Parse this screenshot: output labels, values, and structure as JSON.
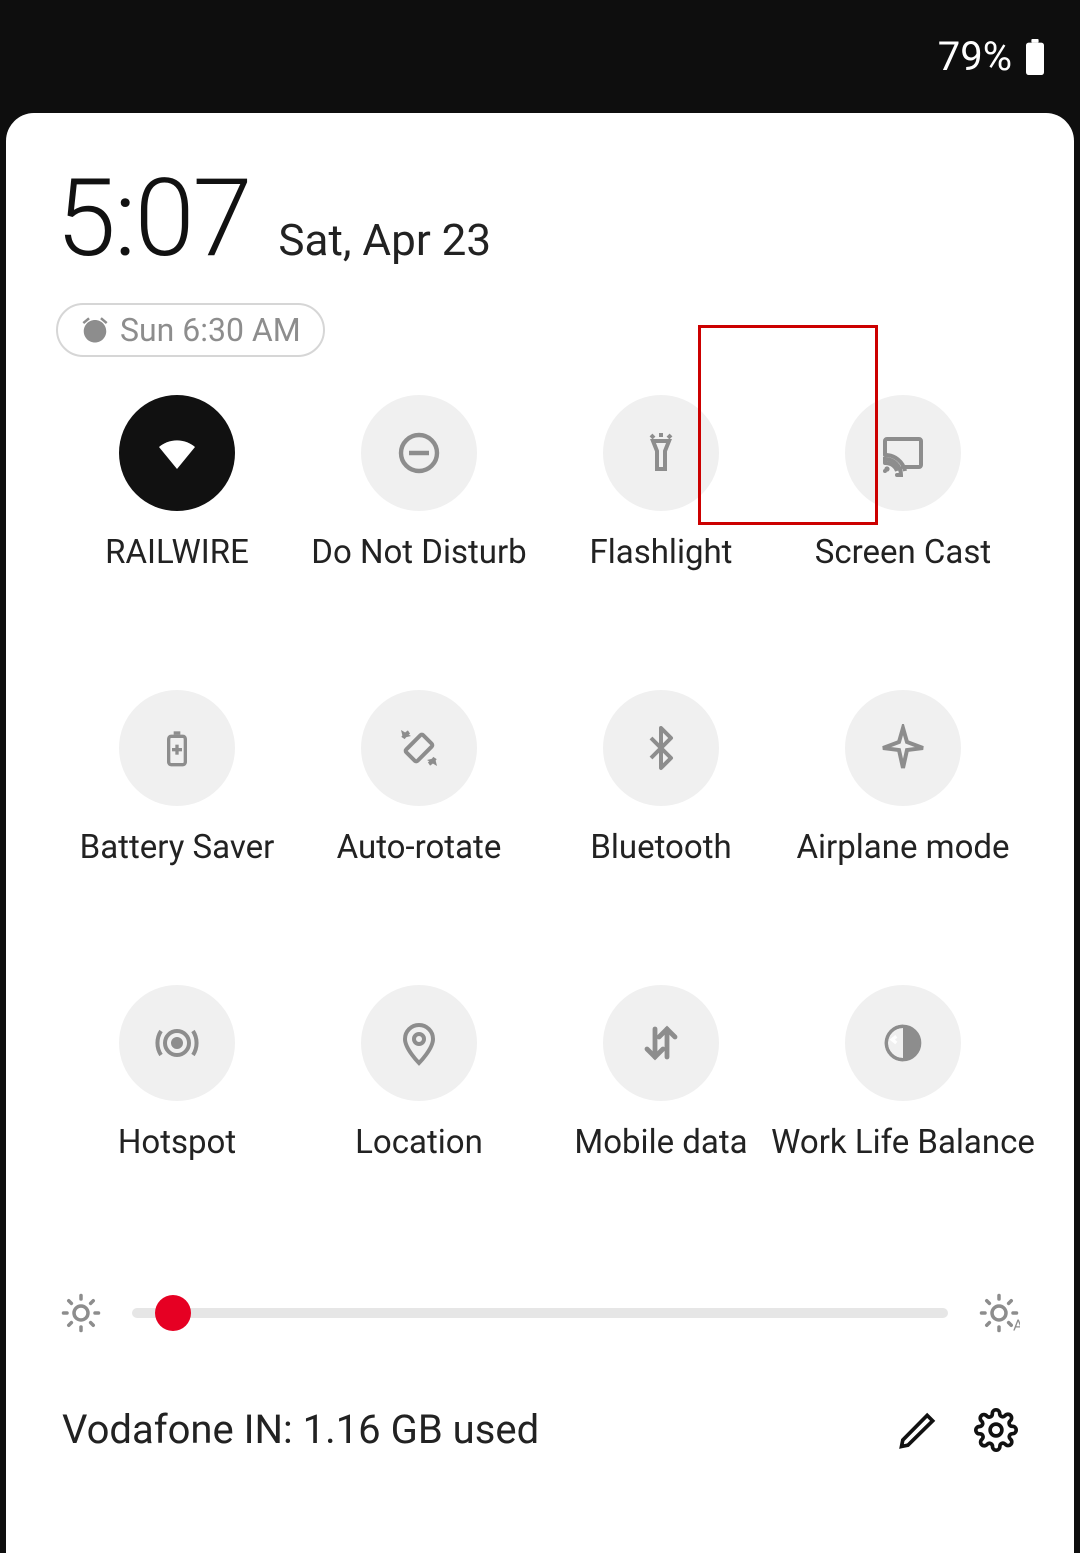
{
  "statusbar": {
    "battery_pct": "79%"
  },
  "header": {
    "time": "5:07",
    "date": "Sat, Apr 23",
    "alarm": "Sun 6:30 AM"
  },
  "tiles": [
    {
      "label": "RAILWIRE",
      "icon": "wifi",
      "active": true
    },
    {
      "label": "Do Not Disturb",
      "icon": "dnd",
      "active": false
    },
    {
      "label": "Flashlight",
      "icon": "flashlight",
      "active": false
    },
    {
      "label": "Screen Cast",
      "icon": "cast",
      "active": false,
      "highlighted": true
    },
    {
      "label": "Battery Saver",
      "icon": "battery-saver",
      "active": false
    },
    {
      "label": "Auto-rotate",
      "icon": "auto-rotate",
      "active": false
    },
    {
      "label": "Bluetooth",
      "icon": "bluetooth",
      "active": false
    },
    {
      "label": "Airplane mode",
      "icon": "airplane",
      "active": false
    },
    {
      "label": "Hotspot",
      "icon": "hotspot",
      "active": false
    },
    {
      "label": "Location",
      "icon": "location",
      "active": false
    },
    {
      "label": "Mobile data",
      "icon": "mobiledata",
      "active": false
    },
    {
      "label": "Work Life Balance",
      "icon": "worklife",
      "active": false
    }
  ],
  "brightness": {
    "value_pct": 5
  },
  "footer": {
    "usage": "Vodafone IN: 1.16 GB used"
  },
  "colors": {
    "accent": "#e60023",
    "highlight": "#cc0000"
  }
}
